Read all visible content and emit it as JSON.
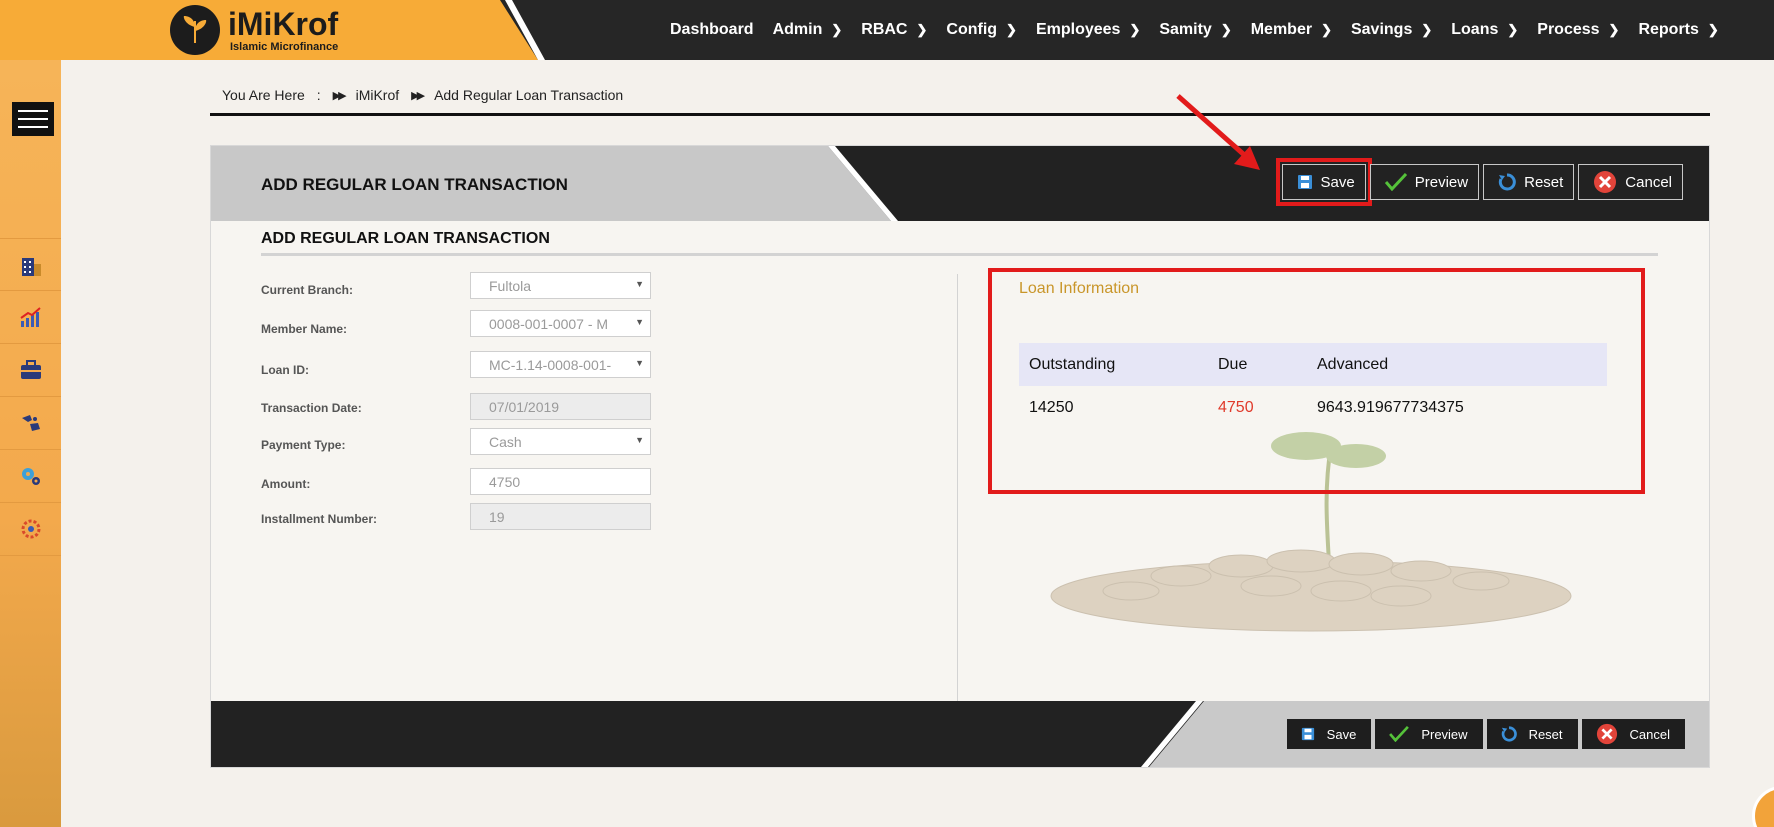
{
  "brand": {
    "name": "iMiKrof",
    "tagline": "Islamic Microfinance"
  },
  "nav": [
    {
      "label": "Dashboard",
      "chevron": false
    },
    {
      "label": "Admin",
      "chevron": true
    },
    {
      "label": "RBAC",
      "chevron": true
    },
    {
      "label": "Config",
      "chevron": true
    },
    {
      "label": "Employees",
      "chevron": true
    },
    {
      "label": "Samity",
      "chevron": true
    },
    {
      "label": "Member",
      "chevron": true
    },
    {
      "label": "Savings",
      "chevron": true
    },
    {
      "label": "Loans",
      "chevron": true
    },
    {
      "label": "Process",
      "chevron": true
    },
    {
      "label": "Reports",
      "chevron": true
    }
  ],
  "sidebar_icons": [
    "building-icon",
    "growth-chart-icon",
    "briefcase-icon",
    "handshake-icon",
    "gears-icon",
    "settings-gear-icon"
  ],
  "breadcrumb": {
    "prefix": "You Are Here",
    "colon": ":",
    "items": [
      "iMiKrof",
      "Add Regular Loan Transaction"
    ]
  },
  "panel": {
    "title": "ADD REGULAR LOAN TRANSACTION",
    "section_title": "ADD REGULAR LOAN TRANSACTION",
    "buttons": {
      "save": "Save",
      "preview": "Preview",
      "reset": "Reset",
      "cancel": "Cancel"
    }
  },
  "form": {
    "current_branch": {
      "label": "Current Branch:",
      "value": "Fultola"
    },
    "member_name": {
      "label": "Member Name:",
      "value": "0008-001-0007 - M"
    },
    "loan_id": {
      "label": "Loan ID:",
      "value": "MC-1.14-0008-001-"
    },
    "transaction_date": {
      "label": "Transaction Date:",
      "value": "07/01/2019"
    },
    "payment_type": {
      "label": "Payment Type:",
      "value": "Cash"
    },
    "amount": {
      "label": "Amount:",
      "value": "4750"
    },
    "installment_number": {
      "label": "Installment Number:",
      "value": "19"
    }
  },
  "loan_info": {
    "title": "Loan Information",
    "headers": {
      "outstanding": "Outstanding",
      "due": "Due",
      "advanced": "Advanced"
    },
    "values": {
      "outstanding": "14250",
      "due": "4750",
      "advanced": "9643.919677734375"
    }
  },
  "footer": {
    "buttons": {
      "save": "Save",
      "preview": "Preview",
      "reset": "Reset",
      "cancel": "Cancel"
    }
  },
  "colors": {
    "brand_orange": "#f7ab37",
    "dark": "#222222",
    "highlight_red": "#e21b1b",
    "due_red": "#e03a2b",
    "loan_title_gold": "#c9962a"
  }
}
